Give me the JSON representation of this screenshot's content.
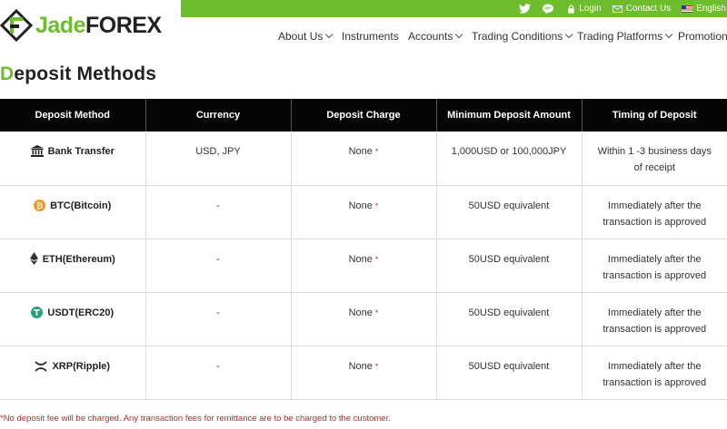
{
  "header": {
    "logo_text_1": "Jade",
    "logo_text_2": "FOREX",
    "topbar": {
      "login": "Login",
      "contact": "Contact Us",
      "language": "English"
    },
    "nav": [
      "About Us",
      "Instruments",
      "Accounts",
      "Trading Conditions",
      "Trading Platforms",
      "Promotions"
    ]
  },
  "page": {
    "title_first": "D",
    "title_rest": "eposit Methods"
  },
  "table": {
    "headers": [
      "Deposit Method",
      "Currency",
      "Deposit Charge",
      "Minimum Deposit Amount",
      "Timing of Deposit"
    ],
    "rows": [
      {
        "icon": "bank-icon",
        "method": "Bank Transfer",
        "currency": "USD, JPY",
        "charge": "None",
        "asterisk": "*",
        "minimum": "1,000USD or 100,000JPY",
        "timing": "Within 1 -3 business days of receipt"
      },
      {
        "icon": "bitcoin-icon",
        "method": "BTC(Bitcoin)",
        "currency": "-",
        "charge": "None",
        "asterisk": "*",
        "minimum": "50USD equivalent",
        "timing": "Immediately after the transaction is approved"
      },
      {
        "icon": "ethereum-icon",
        "method": "ETH(Ethereum)",
        "currency": "-",
        "charge": "None",
        "asterisk": "*",
        "minimum": "50USD equivalent",
        "timing": "Immediately after the transaction is approved"
      },
      {
        "icon": "tether-icon",
        "method": "USDT(ERC20)",
        "currency": "-",
        "charge": "None",
        "asterisk": "*",
        "minimum": "50USD equivalent",
        "timing": "Immediately after the transaction is approved"
      },
      {
        "icon": "ripple-icon",
        "method": "XRP(Ripple)",
        "currency": "-",
        "charge": "None",
        "asterisk": "*",
        "minimum": "50USD equivalent",
        "timing": "Immediately after the transaction is approved"
      }
    ]
  },
  "footnote": "*No deposit fee will be charged. Any transaction fees for remittance are to be charged to the customer.",
  "colors": {
    "brand_green": "#6dbd2d",
    "header_black": "#050505",
    "asterisk_red": "#d32f2f"
  }
}
